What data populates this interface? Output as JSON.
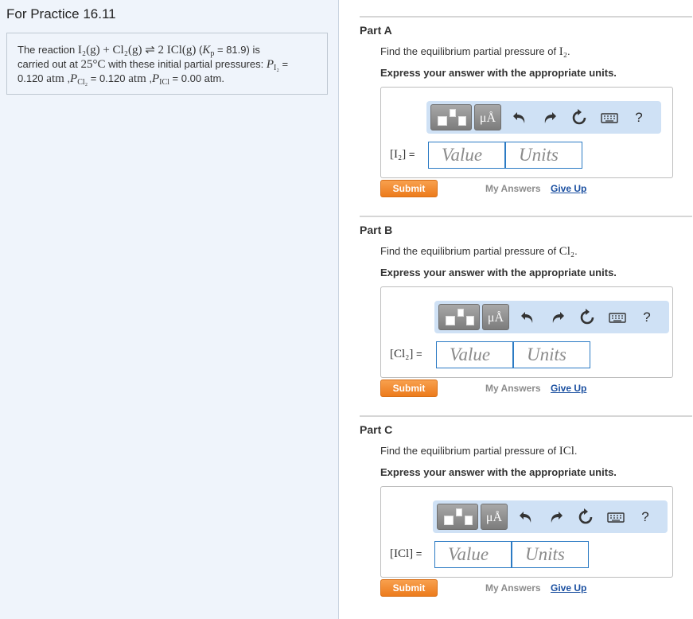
{
  "left": {
    "title": "For Practice 16.11",
    "problem": {
      "prefix": "The reaction ",
      "reaction": "I₂(g) + Cl₂(g) ⇌ 2 ICl(g)",
      "kp_open": " (",
      "kp_symbol": "K",
      "kp_sub": "p",
      "kp_value": " = 81.9",
      "kp_close": ") is",
      "line2_a": "carried out at ",
      "temperature": "25°C",
      "line2_b": " with these initial partial pressures: ",
      "p1_symbol": "P",
      "p1_sub": "I₂",
      "eq": " =",
      "p1_value": "0.120",
      "unit_atm": " atm",
      "comma": " ,",
      "p2_symbol": "P",
      "p2_sub": "Cl₂",
      "p2_value": " = 0.120",
      "p3_symbol": "P",
      "p3_sub": "ICl",
      "p3_value": " = 0.00 atm."
    }
  },
  "toolbar": {
    "mu_label": "μÅ",
    "help_label": "?",
    "icons": [
      "template-icon",
      "units-icon",
      "undo-icon",
      "redo-icon",
      "reset-icon",
      "keyboard-icon",
      "help-icon"
    ]
  },
  "parts": [
    {
      "title": "Part A",
      "question_prefix": "Find the equilibrium partial pressure of ",
      "species": "I₂",
      "question_suffix": ".",
      "instruction": "Express your answer with the appropriate units.",
      "answer_label": "[I₂]",
      "equals": " =",
      "value_placeholder": "Value",
      "units_placeholder": "Units",
      "submit": "Submit",
      "my_answers": "My Answers",
      "give_up": "Give Up"
    },
    {
      "title": "Part B",
      "question_prefix": "Find the equilibrium partial pressure of ",
      "species": "Cl₂",
      "question_suffix": ".",
      "instruction": "Express your answer with the appropriate units.",
      "answer_label": "[Cl₂]",
      "equals": " =",
      "value_placeholder": "Value",
      "units_placeholder": "Units",
      "submit": "Submit",
      "my_answers": "My Answers",
      "give_up": "Give Up"
    },
    {
      "title": "Part C",
      "question_prefix": "Find the equilibrium partial pressure of ",
      "species": "ICl",
      "question_suffix": ".",
      "instruction": "Express your answer with the appropriate units.",
      "answer_label": "[ICl]",
      "equals": " =",
      "value_placeholder": "Value",
      "units_placeholder": "Units",
      "submit": "Submit",
      "my_answers": "My Answers",
      "give_up": "Give Up"
    }
  ]
}
